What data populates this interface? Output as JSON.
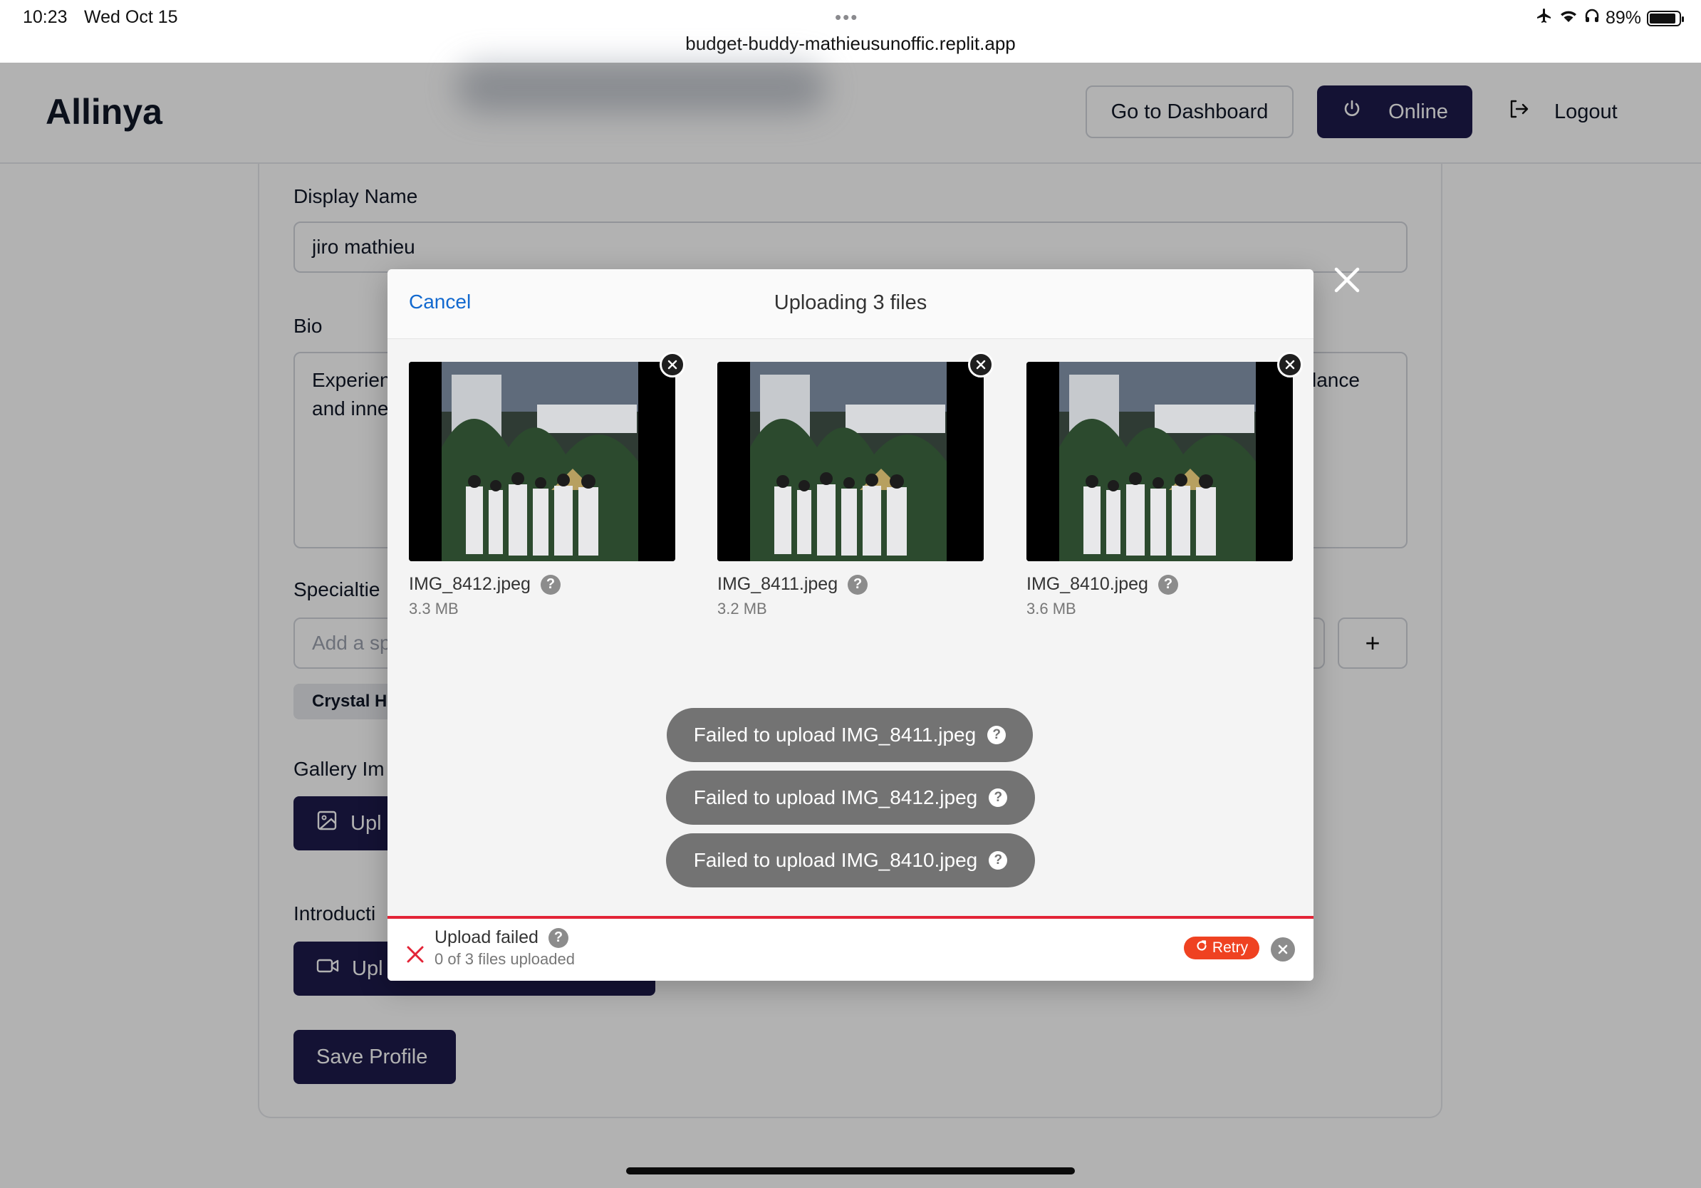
{
  "status_bar": {
    "time": "10:23",
    "date": "Wed Oct 15",
    "url": "budget-buddy-mathieusunoffic.replit.app",
    "battery": "89%",
    "battery_level": 0.89
  },
  "header": {
    "brand": "Allinya",
    "dashboard_label": "Go to Dashboard",
    "online_label": "Online",
    "logout_label": "Logout"
  },
  "profile_form": {
    "display_name_label": "Display Name",
    "display_name_value": "jiro mathieu",
    "bio_label": "Bio",
    "bio_visible_left_line1": "Experien",
    "bio_visible_left_line2": "and inne",
    "bio_visible_right": "lance",
    "specialties_label": "Specialtie",
    "specialty_placeholder": "Add a sp",
    "specialty_chip": "Crystal H",
    "gallery_label": "Gallery Im",
    "gallery_button": "Upl",
    "intro_label": "Introducti",
    "intro_button": "Upl",
    "save_button": "Save Profile"
  },
  "upload_modal": {
    "cancel_label": "Cancel",
    "title": "Uploading 3 files",
    "files": [
      {
        "name": "IMG_8412.jpeg",
        "size": "3.3 MB"
      },
      {
        "name": "IMG_8411.jpeg",
        "size": "3.2 MB"
      },
      {
        "name": "IMG_8410.jpeg",
        "size": "3.6 MB"
      }
    ],
    "errors": [
      "Failed to upload IMG_8411.jpeg",
      "Failed to upload IMG_8412.jpeg",
      "Failed to upload IMG_8410.jpeg"
    ],
    "status_title": "Upload failed",
    "status_sub": "0 of 3 files uploaded",
    "retry_label": "Retry",
    "question_glyph": "?"
  },
  "colors": {
    "brand_dark": "#1e1b4b",
    "link_blue": "#1269cf",
    "error_red": "#e32437",
    "retry_orange": "#ef4221"
  }
}
